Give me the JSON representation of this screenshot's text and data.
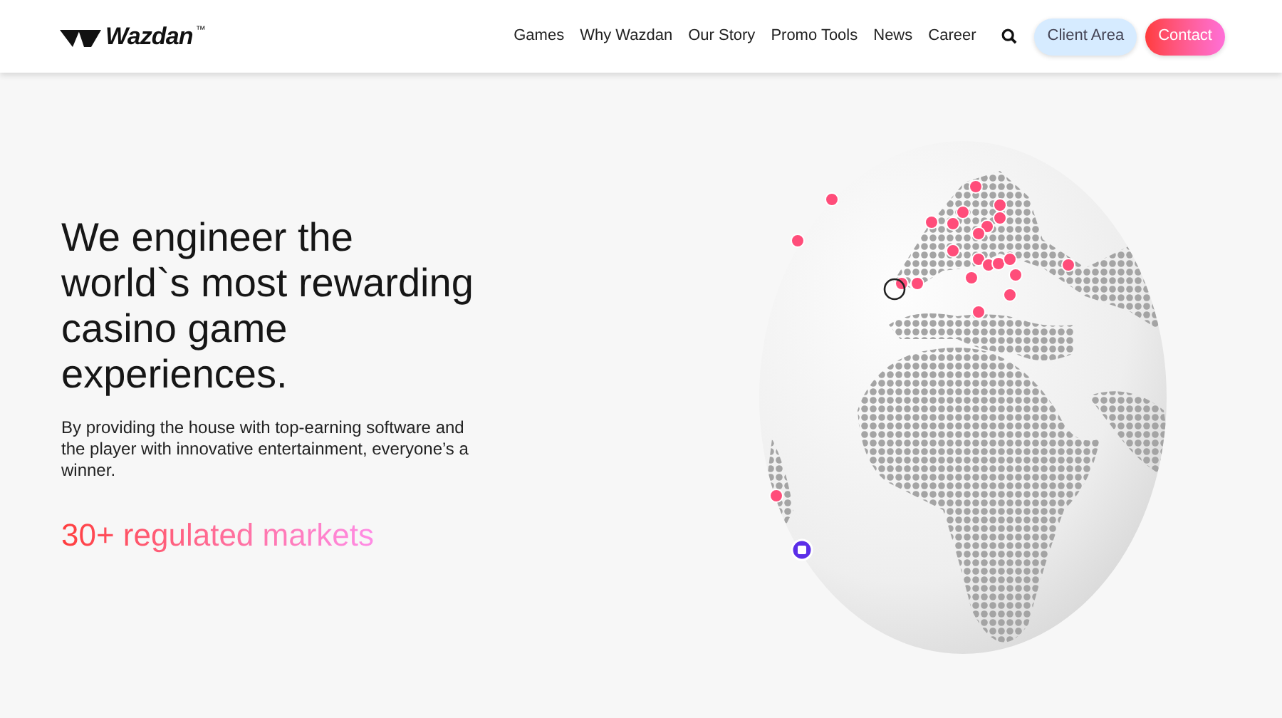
{
  "header": {
    "logo": "Wazdan",
    "trademark": "™",
    "nav": [
      {
        "label": "Games"
      },
      {
        "label": "Why Wazdan"
      },
      {
        "label": "Our Story"
      },
      {
        "label": "Promo Tools"
      },
      {
        "label": "News"
      },
      {
        "label": "Career"
      }
    ],
    "buttons": [
      {
        "label": "Client Area",
        "kind": "secondary"
      },
      {
        "label": "Contact",
        "kind": "primary"
      }
    ]
  },
  "hero": {
    "headline": "We engineer the world`s most rewarding casino game experiences.",
    "text": "By providing the house with top-earning software and the player with innovative entertainment, everyone’s a winner.",
    "highlight": "30+ regulated markets"
  }
}
